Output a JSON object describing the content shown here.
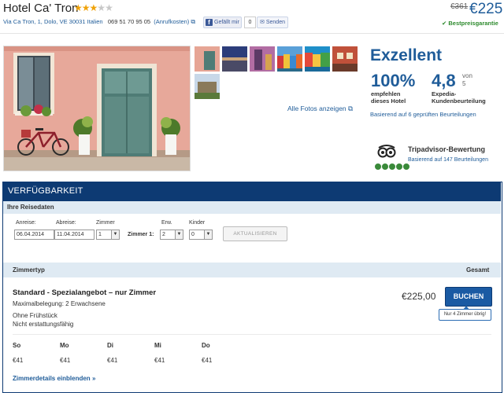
{
  "header": {
    "hotel_name": "Hotel Ca' Tron",
    "star_count": 3,
    "stars_max": 5,
    "address": "Via Ca Tron, 1, Dolo, VE 30031 Italien",
    "phone": "069 51 70 95 05",
    "call_cost_link": "(Anrufkosten)",
    "fb_like": "Gefällt mir",
    "fb_count": "0",
    "send": "Senden",
    "price_old": "€361",
    "price_new": "€225",
    "best_price": "Bestpreisgarantie"
  },
  "gallery": {
    "all_photos": "Alle Fotos anzeigen"
  },
  "rating": {
    "title": "Exzellent",
    "percent": "100%",
    "percent_label_1": "empfehlen",
    "percent_label_2": "dieses Hotel",
    "score": "4,8",
    "score_von": "von",
    "score_max": "5",
    "score_label_1": "Expedia-",
    "score_label_2": "Kundenbeurteilung",
    "based_on": "Basierend auf 6 geprüften Beurteilungen",
    "tripadvisor_title": "Tripadvisor-Bewertung",
    "tripadvisor_based": "Basierend auf 147 Beurteilungen",
    "tripadvisor_score": 5
  },
  "availability": {
    "title": "VERFÜGBARKEIT",
    "travel_data_title": "Ihre Reisedaten",
    "arrival_label": "Anreise:",
    "arrival_value": "06.04.2014",
    "departure_label": "Abreise:",
    "departure_value": "11.04.2014",
    "rooms_label": "Zimmer",
    "rooms_value": "1",
    "room1_label": "Zimmer 1:",
    "adults_label": "Erw.",
    "adults_value": "2",
    "children_label": "Kinder",
    "children_value": "0",
    "refresh": "AKTUALISIEREN",
    "room_type_header": "Zimmertyp",
    "total_header": "Gesamt",
    "room": {
      "name": "Standard - Spezialangebot – nur Zimmer",
      "occupancy": "Maximalbelegung: 2 Erwachsene",
      "breakfast": "Ohne Frühstück",
      "refund": "Nicht erstattungsfähig",
      "price": "€225,00",
      "book": "BUCHEN",
      "rooms_left": "Nur 4 Zimmer übrig!",
      "nights": [
        {
          "day": "So",
          "price": "€41"
        },
        {
          "day": "Mo",
          "price": "€41"
        },
        {
          "day": "Di",
          "price": "€41"
        },
        {
          "day": "Mi",
          "price": "€41"
        },
        {
          "day": "Do",
          "price": "€41"
        }
      ],
      "details_link": "Zimmerdetails einblenden"
    }
  },
  "colors": {
    "brand_blue": "#1f5c99",
    "panel_navy": "#0d3a73",
    "star_gold": "#f0a30a",
    "green": "#2d8a2d"
  }
}
